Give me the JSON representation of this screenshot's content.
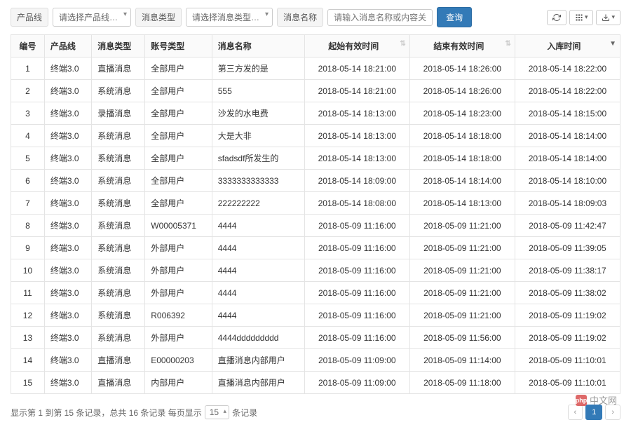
{
  "filters": {
    "product_line_label": "产品线",
    "product_line_placeholder": "请选择产品线…",
    "msg_type_label": "消息类型",
    "msg_type_placeholder": "请选择消息类型…",
    "msg_name_label": "消息名称",
    "search_placeholder": "请输入消息名称或内容关键",
    "query_btn": "查询"
  },
  "columns": {
    "id": "编号",
    "product_line": "产品线",
    "msg_type": "消息类型",
    "account_type": "账号类型",
    "msg_name": "消息名称",
    "start_time": "起始有效时间",
    "end_time": "结束有效时间",
    "created_time": "入库时间"
  },
  "rows": [
    {
      "id": "1",
      "product_line": "终端3.0",
      "msg_type": "直播消息",
      "account_type": "全部用户",
      "msg_name": "第三方发的是",
      "start": "2018-05-14 18:21:00",
      "end": "2018-05-14 18:26:00",
      "created": "2018-05-14 18:22:00"
    },
    {
      "id": "2",
      "product_line": "终端3.0",
      "msg_type": "系统消息",
      "account_type": "全部用户",
      "msg_name": "555",
      "start": "2018-05-14 18:21:00",
      "end": "2018-05-14 18:26:00",
      "created": "2018-05-14 18:22:00"
    },
    {
      "id": "3",
      "product_line": "终端3.0",
      "msg_type": "录播消息",
      "account_type": "全部用户",
      "msg_name": "沙发的水电费",
      "start": "2018-05-14 18:13:00",
      "end": "2018-05-14 18:23:00",
      "created": "2018-05-14 18:15:00"
    },
    {
      "id": "4",
      "product_line": "终端3.0",
      "msg_type": "系统消息",
      "account_type": "全部用户",
      "msg_name": "大是大非",
      "start": "2018-05-14 18:13:00",
      "end": "2018-05-14 18:18:00",
      "created": "2018-05-14 18:14:00"
    },
    {
      "id": "5",
      "product_line": "终端3.0",
      "msg_type": "系统消息",
      "account_type": "全部用户",
      "msg_name": "sfadsdf所发生的",
      "start": "2018-05-14 18:13:00",
      "end": "2018-05-14 18:18:00",
      "created": "2018-05-14 18:14:00"
    },
    {
      "id": "6",
      "product_line": "终端3.0",
      "msg_type": "系统消息",
      "account_type": "全部用户",
      "msg_name": "3333333333333",
      "start": "2018-05-14 18:09:00",
      "end": "2018-05-14 18:14:00",
      "created": "2018-05-14 18:10:00"
    },
    {
      "id": "7",
      "product_line": "终端3.0",
      "msg_type": "系统消息",
      "account_type": "全部用户",
      "msg_name": "222222222",
      "start": "2018-05-14 18:08:00",
      "end": "2018-05-14 18:13:00",
      "created": "2018-05-14 18:09:03"
    },
    {
      "id": "8",
      "product_line": "终端3.0",
      "msg_type": "系统消息",
      "account_type": "W00005371",
      "msg_name": "4444",
      "start": "2018-05-09 11:16:00",
      "end": "2018-05-09 11:21:00",
      "created": "2018-05-09 11:42:47"
    },
    {
      "id": "9",
      "product_line": "终端3.0",
      "msg_type": "系统消息",
      "account_type": "外部用户",
      "msg_name": "4444",
      "start": "2018-05-09 11:16:00",
      "end": "2018-05-09 11:21:00",
      "created": "2018-05-09 11:39:05"
    },
    {
      "id": "10",
      "product_line": "终端3.0",
      "msg_type": "系统消息",
      "account_type": "外部用户",
      "msg_name": "4444",
      "start": "2018-05-09 11:16:00",
      "end": "2018-05-09 11:21:00",
      "created": "2018-05-09 11:38:17"
    },
    {
      "id": "11",
      "product_line": "终端3.0",
      "msg_type": "系统消息",
      "account_type": "外部用户",
      "msg_name": "4444",
      "start": "2018-05-09 11:16:00",
      "end": "2018-05-09 11:21:00",
      "created": "2018-05-09 11:38:02"
    },
    {
      "id": "12",
      "product_line": "终端3.0",
      "msg_type": "系统消息",
      "account_type": "R006392",
      "msg_name": "4444",
      "start": "2018-05-09 11:16:00",
      "end": "2018-05-09 11:21:00",
      "created": "2018-05-09 11:19:02"
    },
    {
      "id": "13",
      "product_line": "终端3.0",
      "msg_type": "系统消息",
      "account_type": "外部用户",
      "msg_name": "4444ddddddddd",
      "start": "2018-05-09 11:16:00",
      "end": "2018-05-09 11:56:00",
      "created": "2018-05-09 11:19:02"
    },
    {
      "id": "14",
      "product_line": "终端3.0",
      "msg_type": "直播消息",
      "account_type": "E00000203",
      "msg_name": "直播消息内部用户",
      "start": "2018-05-09 11:09:00",
      "end": "2018-05-09 11:14:00",
      "created": "2018-05-09 11:10:01"
    },
    {
      "id": "15",
      "product_line": "终端3.0",
      "msg_type": "直播消息",
      "account_type": "内部用户",
      "msg_name": "直播消息内部用户",
      "start": "2018-05-09 11:09:00",
      "end": "2018-05-09 11:18:00",
      "created": "2018-05-09 11:10:01"
    }
  ],
  "pagination": {
    "summary_prefix": "显示第 1 到第 15 条记录，总共 16 条记录 每页显示",
    "summary_suffix": "条记录",
    "page_size": "15",
    "prev": "‹",
    "current": "1",
    "next": "›"
  },
  "watermark": {
    "logo_text": "php",
    "text": "中文网"
  }
}
